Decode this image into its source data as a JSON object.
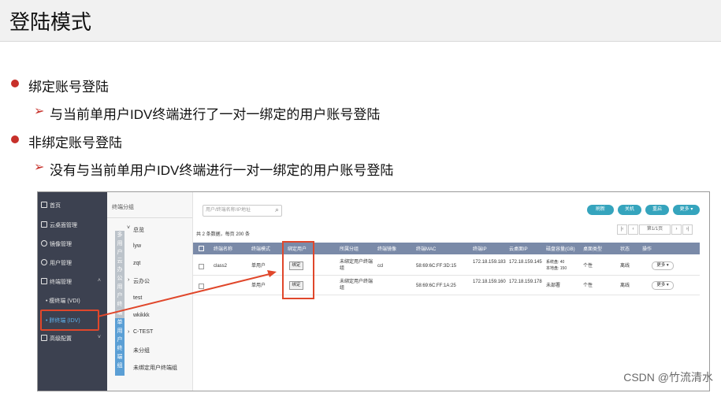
{
  "slide": {
    "title": "登陆模式",
    "bullets": [
      {
        "text": "绑定账号登陆",
        "sub": "与当前单用户IDV终端进行了一对一绑定的用户账号登陆"
      },
      {
        "text": "非绑定账号登陆",
        "sub": "没有与当前单用户IDV终端进行一对一绑定的用户账号登陆"
      }
    ],
    "watermark": "CSDN @竹流清水"
  },
  "colors": {
    "accent": "#c7302a",
    "highlight": "#e0472b",
    "sidebar": "#3c4150",
    "teal": "#35a4bd",
    "table_header": "#7a8aa8"
  },
  "sidebar": {
    "items": [
      {
        "label": "首页",
        "icon": "home-icon"
      },
      {
        "label": "云桌面管理",
        "icon": "monitor-icon"
      },
      {
        "label": "镜像管理",
        "icon": "image-icon"
      },
      {
        "label": "用户管理",
        "icon": "user-icon"
      },
      {
        "label": "终端管理",
        "icon": "terminal-icon"
      },
      {
        "label": "高级配置",
        "icon": "settings-icon"
      }
    ],
    "subitems": [
      "• 瘦终端 (VDI)",
      "• 胖终端 (IDV)"
    ]
  },
  "tree": {
    "header": "终端分组",
    "tab_top": "多用户云办公用户终端组",
    "tab_bottom": "单用户终端组",
    "nodes": [
      "总览",
      "lyw",
      "zqt",
      "云办公",
      "test",
      "wkikkk",
      "C-TEST",
      "未分组",
      "未绑定用户终端组"
    ],
    "toggles": [
      "˅",
      "›",
      "›"
    ]
  },
  "toolbar": {
    "search_placeholder": "用户/终端名称/IP地址",
    "buttons": [
      "刷新",
      "关机",
      "重启",
      "更多 ▾"
    ]
  },
  "summary": "共 2 条数据，每页 200 条",
  "pager": {
    "first": "|‹",
    "prev": "‹",
    "page": "第1/1页",
    "next": "›",
    "last": "›|"
  },
  "table": {
    "headers": [
      "终端名称",
      "终端模式",
      "绑定用户",
      "所属分组",
      "终端镜像",
      "终端MAC",
      "终端IP",
      "云桌面IP",
      "磁盘容量(GB)",
      "桌面类型",
      "状态",
      "操作"
    ],
    "rows": [
      {
        "name": "class2",
        "mode": "单用户",
        "bind": "绑定",
        "group": "未绑定用户终端组",
        "image": "ccl",
        "mac": "58:69:6C:FF:3D:15",
        "ip": "172.18.159.183",
        "vip": "172.18.159.145",
        "disk": "系统盘: 40\n本地盘: 150",
        "dtype": "个性",
        "status": "离线",
        "op": "更多 ▾"
      },
      {
        "name": "",
        "mode": "单用户",
        "bind": "绑定",
        "group": "未绑定用户终端组",
        "image": "",
        "mac": "58:69:6C:FF:1A:25",
        "ip": "172.18.159.160",
        "vip": "172.18.159.178",
        "disk": "未部署",
        "dtype": "个性",
        "status": "离线",
        "op": "更多 ▾"
      }
    ]
  }
}
